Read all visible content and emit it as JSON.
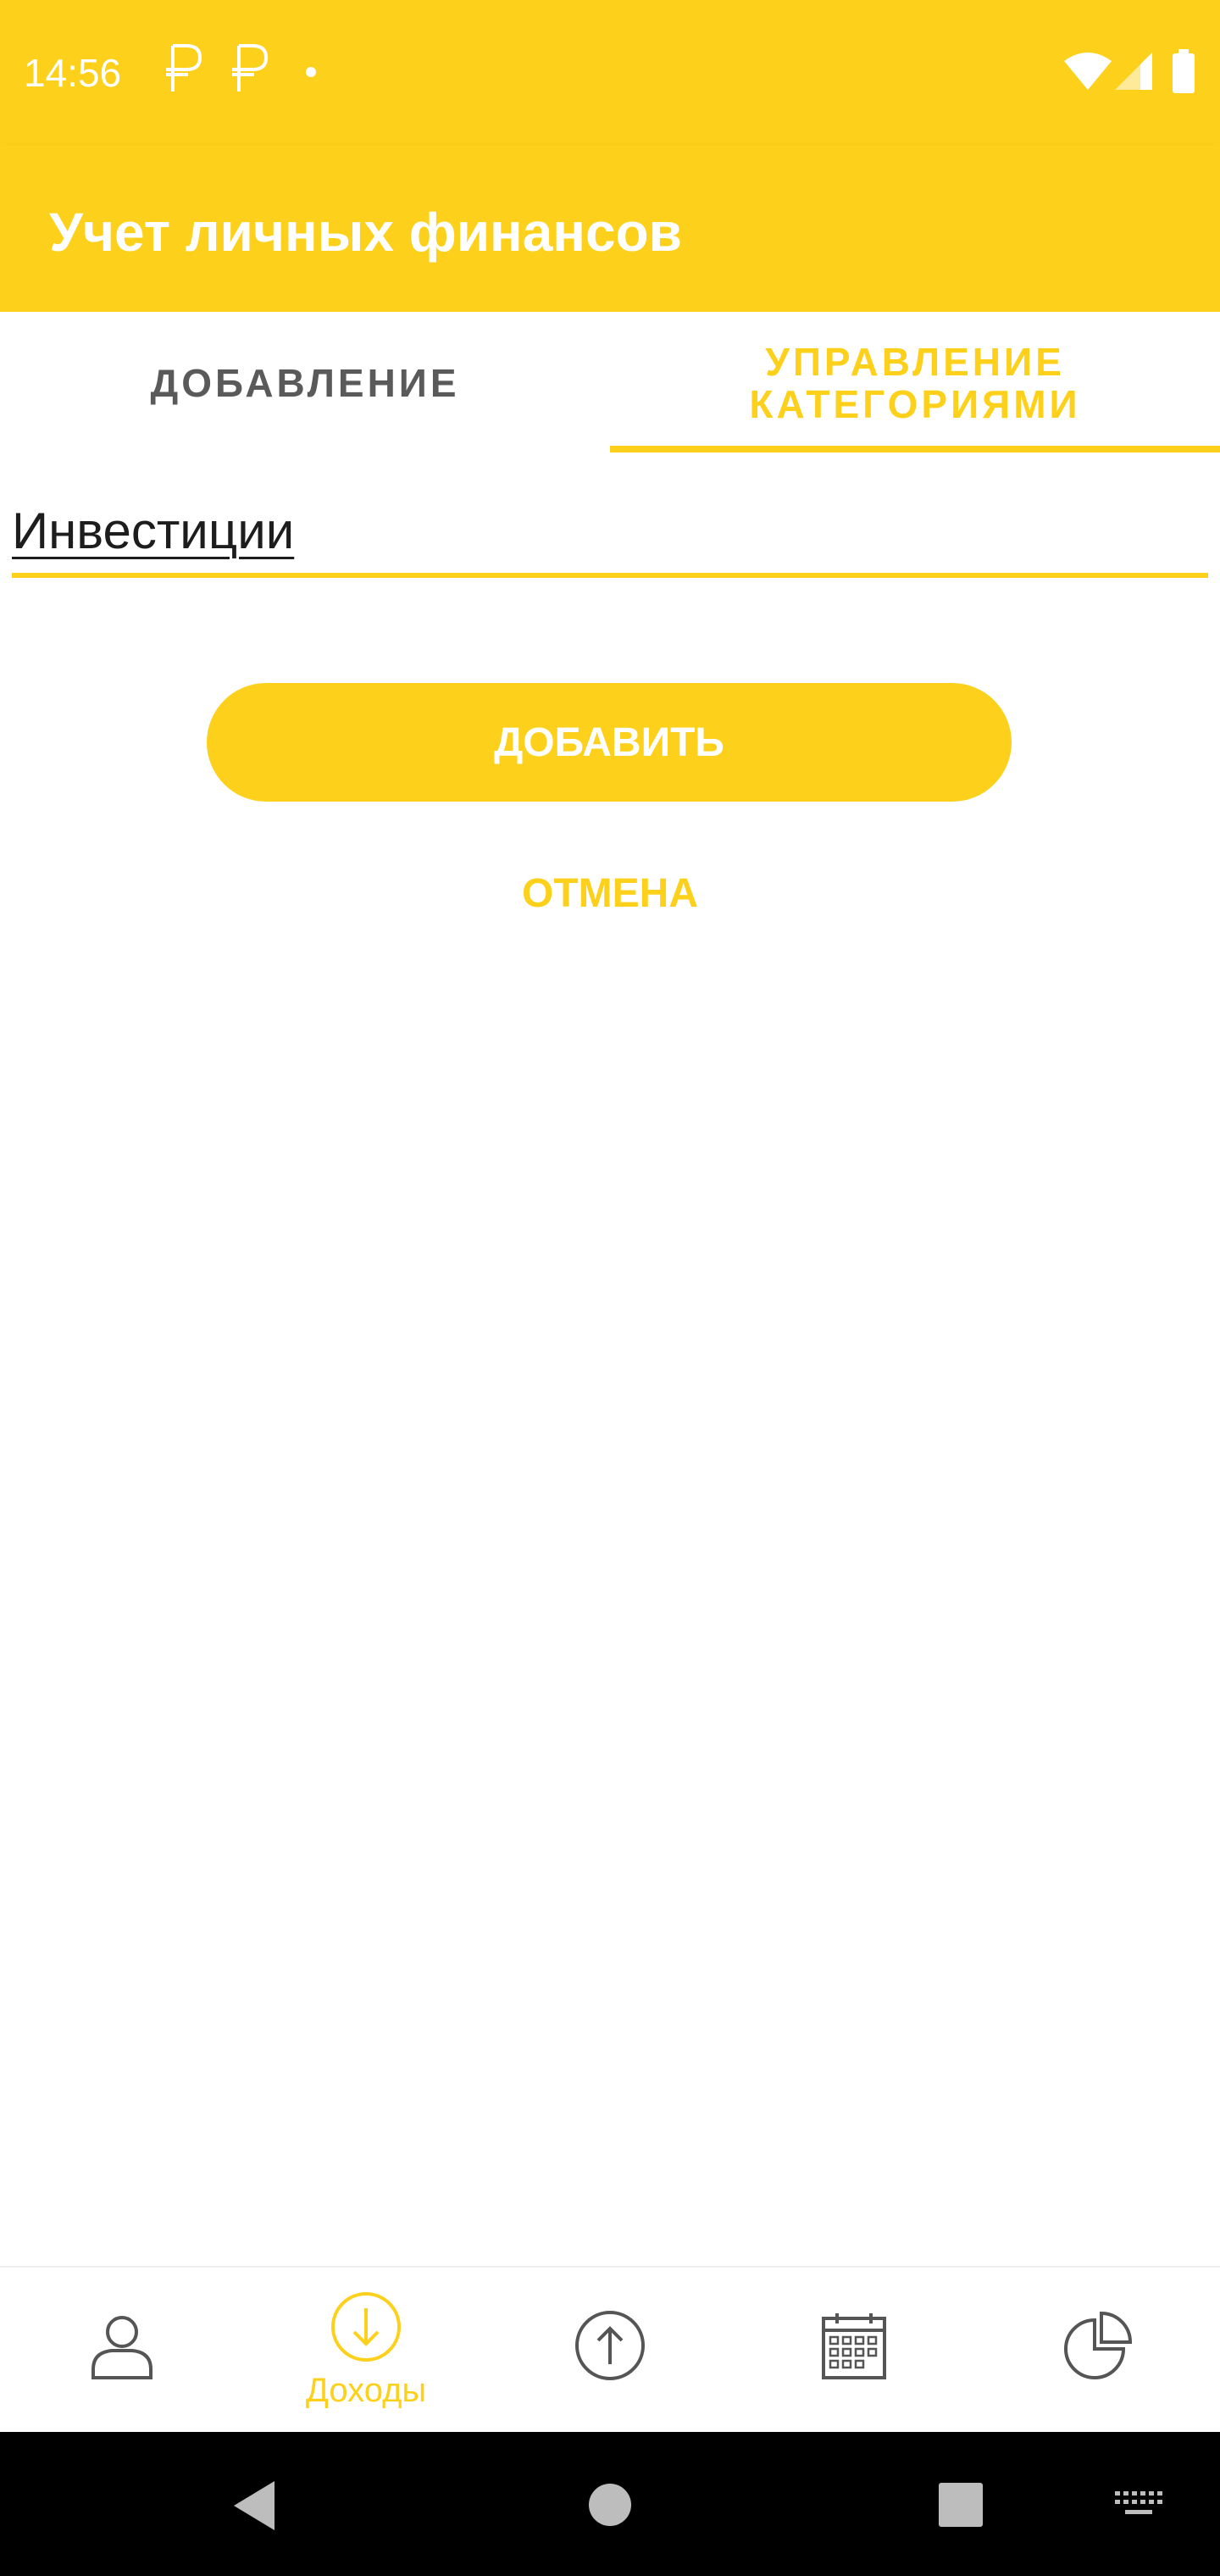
{
  "status_bar": {
    "time": "14:56",
    "notification_icons": [
      "ruble-icon",
      "ruble-icon",
      "dot-icon"
    ],
    "system_icons": [
      "wifi-icon",
      "signal-icon",
      "battery-icon"
    ]
  },
  "app_bar": {
    "title": "Учет личных финансов"
  },
  "tabs": [
    {
      "label": "ДОБАВЛЕНИЕ",
      "selected": false
    },
    {
      "label": "УПРАВЛЕНИЕ КАТЕГОРИЯМИ",
      "selected": true
    }
  ],
  "form": {
    "category_value": "Инвестиции",
    "add_button": "ДОБАВИТЬ",
    "cancel_button": "ОТМЕНА"
  },
  "bottom_nav": [
    {
      "icon": "person-icon",
      "label": "",
      "selected": false
    },
    {
      "icon": "income-icon",
      "label": "Доходы",
      "selected": true
    },
    {
      "icon": "expense-icon",
      "label": "",
      "selected": false
    },
    {
      "icon": "calendar-icon",
      "label": "",
      "selected": false
    },
    {
      "icon": "pie-chart-icon",
      "label": "",
      "selected": false
    }
  ],
  "system_nav": [
    "back-icon",
    "home-icon",
    "recents-icon",
    "keyboard-icon"
  ],
  "colors": {
    "accent": "#FDD11B",
    "text_dark": "#5a5a5a",
    "icon_gray": "#555555"
  }
}
